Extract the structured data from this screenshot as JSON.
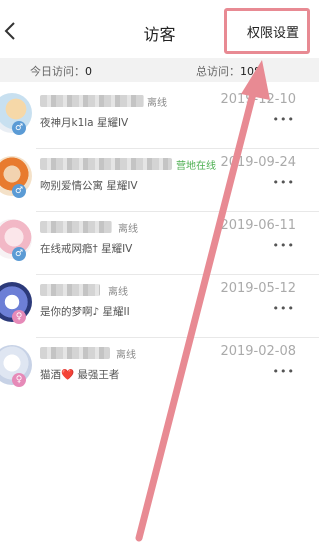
{
  "header": {
    "title": "访客",
    "perm_label": "权限设置"
  },
  "stats": {
    "today_label": "今日访问：",
    "today_value": "0",
    "total_label": "总访问：",
    "total_value": "108"
  },
  "visitors": [
    {
      "status": "离线",
      "sub": "夜神月k1la 星耀IV",
      "date": "2019-12-10",
      "more": "•••"
    },
    {
      "status": "营地在线",
      "sub": "吻别爱情公寓 星耀IV",
      "date": "2019-09-24",
      "more": "•••"
    },
    {
      "status": "离线",
      "sub": "在线戒网瘾† 星耀IV",
      "date": "2019-06-11",
      "more": "•••"
    },
    {
      "status": "离线",
      "sub": "是你的梦啊♪ 星耀II",
      "date": "2019-05-12",
      "more": "•••"
    },
    {
      "status": "离线",
      "sub": "猫酒❤️ 最强王者",
      "date": "2019-02-08",
      "more": "•••"
    }
  ],
  "colors": {
    "online": "#4caf50",
    "male": "#5b9bd5",
    "female": "#e68ab8",
    "annotation": "#e88a93"
  }
}
